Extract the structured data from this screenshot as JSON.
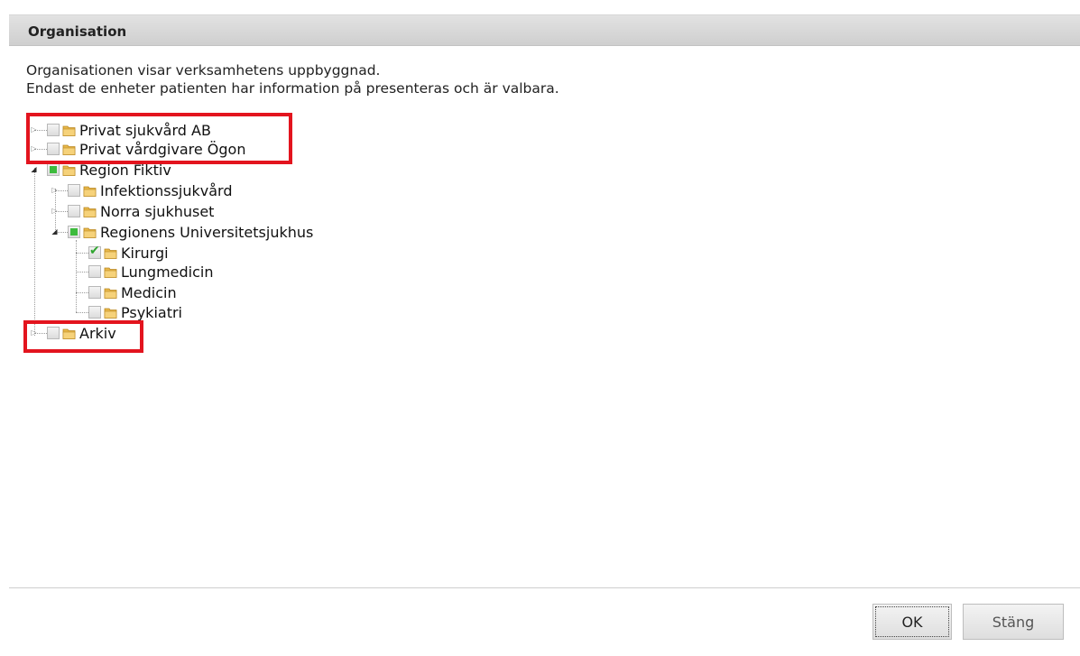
{
  "dialog": {
    "title": "Organisation",
    "intro_line1": "Organisationen visar verksamhetens uppbyggnad.",
    "intro_line2": "Endast de enheter patienten har information på presenteras och är valbara."
  },
  "tree": {
    "privat_sjukvard": {
      "label": "Privat sjukvård AB",
      "state": "unchecked",
      "expanded": false
    },
    "privat_vardgivare": {
      "label": "Privat vårdgivare Ögon",
      "state": "unchecked",
      "expanded": false
    },
    "region_fiktiv": {
      "label": "Region Fiktiv",
      "state": "partial",
      "expanded": true
    },
    "infektion": {
      "label": "Infektionssjukvård",
      "state": "unchecked",
      "expanded": false
    },
    "norra": {
      "label": "Norra sjukhuset",
      "state": "unchecked",
      "expanded": false
    },
    "regionens_us": {
      "label": "Regionens Universitetsjukhus",
      "state": "partial",
      "expanded": true
    },
    "kirurgi": {
      "label": "Kirurgi",
      "state": "checked"
    },
    "lungmedicin": {
      "label": "Lungmedicin",
      "state": "unchecked"
    },
    "medicin": {
      "label": "Medicin",
      "state": "unchecked"
    },
    "psykiatri": {
      "label": "Psykiatri",
      "state": "unchecked"
    },
    "arkiv": {
      "label": "Arkiv",
      "state": "unchecked",
      "expanded": false
    }
  },
  "buttons": {
    "ok": "OK",
    "close": "Stäng"
  },
  "colors": {
    "highlight": "#e3141e",
    "check_green": "#2fa52f",
    "partial_green": "#3dbb3d",
    "folder": "#e8b84a"
  }
}
